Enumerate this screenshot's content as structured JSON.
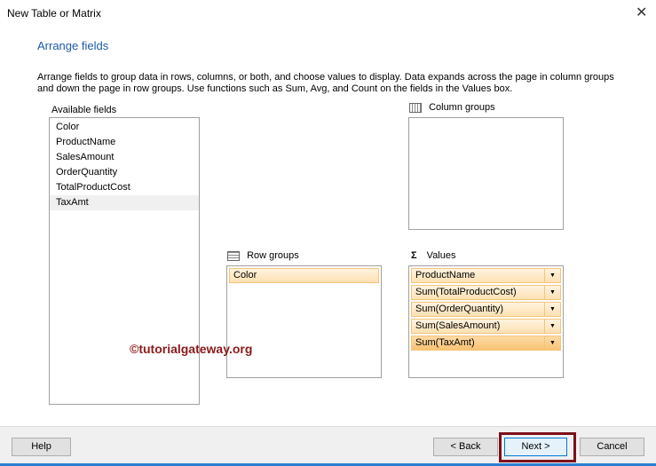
{
  "window": {
    "title": "New Table or Matrix",
    "close": "✕"
  },
  "page": {
    "heading": "Arrange fields",
    "description": "Arrange fields to group data in rows, columns, or both, and choose values to display. Data expands across the page in column groups and down the page in row groups.  Use functions such as Sum, Avg, and Count on the fields in the Values box."
  },
  "available": {
    "label": "Available fields",
    "items": [
      "Color",
      "ProductName",
      "SalesAmount",
      "OrderQuantity",
      "TotalProductCost",
      "TaxAmt"
    ]
  },
  "column_groups": {
    "label": "Column groups"
  },
  "row_groups": {
    "label": "Row groups",
    "items": [
      "Color"
    ]
  },
  "values": {
    "label": "Values",
    "icon": "Σ",
    "items": [
      "ProductName",
      "Sum(TotalProductCost)",
      "Sum(OrderQuantity)",
      "Sum(SalesAmount)",
      "Sum(TaxAmt)"
    ]
  },
  "watermark": "©tutorialgateway.org",
  "buttons": {
    "help": "Help",
    "back": "< Back",
    "next": "Next >",
    "cancel": "Cancel"
  }
}
